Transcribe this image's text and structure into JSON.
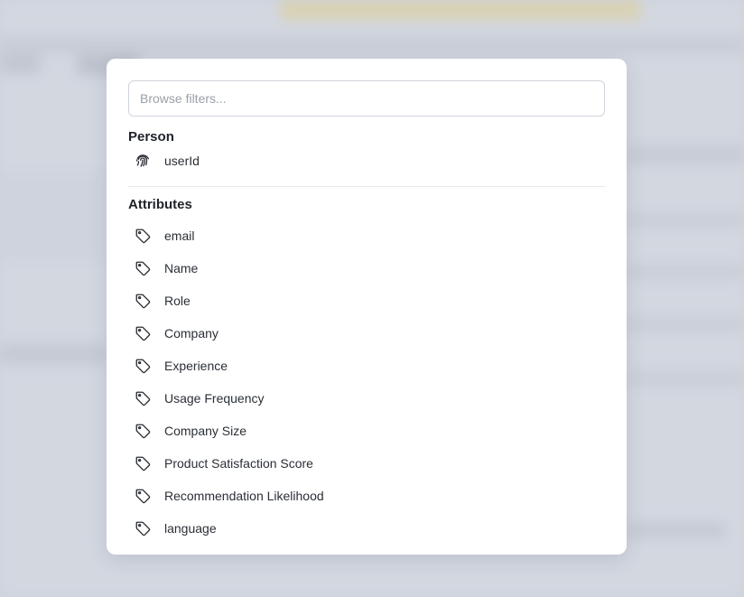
{
  "search": {
    "placeholder": "Browse filters..."
  },
  "groups": {
    "person": {
      "title": "Person",
      "items": [
        {
          "label": "userId",
          "icon": "fingerprint-icon"
        }
      ]
    },
    "attributes": {
      "title": "Attributes",
      "items": [
        {
          "label": "email",
          "icon": "tag-icon"
        },
        {
          "label": "Name",
          "icon": "tag-icon"
        },
        {
          "label": "Role",
          "icon": "tag-icon"
        },
        {
          "label": "Company",
          "icon": "tag-icon"
        },
        {
          "label": "Experience",
          "icon": "tag-icon"
        },
        {
          "label": "Usage Frequency",
          "icon": "tag-icon"
        },
        {
          "label": "Company Size",
          "icon": "tag-icon"
        },
        {
          "label": "Product Satisfaction Score",
          "icon": "tag-icon"
        },
        {
          "label": "Recommendation Likelihood",
          "icon": "tag-icon"
        },
        {
          "label": "language",
          "icon": "tag-icon"
        }
      ]
    }
  },
  "colors": {
    "modal_bg": "#ffffff",
    "backdrop": "#dfe3ea",
    "text": "#2a2f36",
    "muted": "#9aa0a8",
    "banner": "#f3e6b8"
  }
}
